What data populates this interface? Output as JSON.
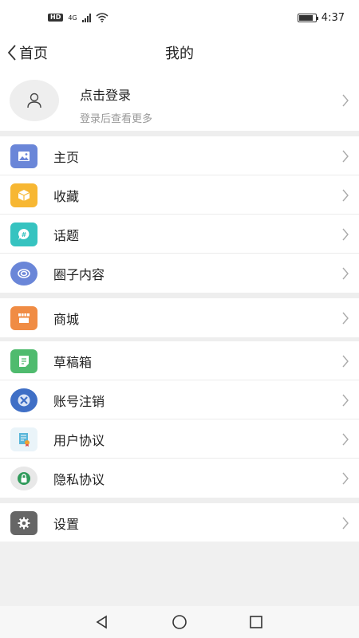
{
  "status_bar": {
    "hd": "HD",
    "network": "4G",
    "time": "4:37",
    "battery_level": 0.85
  },
  "nav": {
    "back_label": "首页",
    "title": "我的"
  },
  "profile": {
    "name": "点击登录",
    "subtitle": "登录后查看更多"
  },
  "menu": {
    "home": "主页",
    "favorites": "收藏",
    "topics": "话题",
    "circle": "圈子内容",
    "mall": "商城",
    "drafts": "草稿箱",
    "account_cancel": "账号注销",
    "user_agreement": "用户协议",
    "privacy": "隐私协议",
    "settings": "设置"
  },
  "colors": {
    "home_icon": "#6a86d8",
    "favorites_icon": "#f7b733",
    "topics_icon": "#36c3c0",
    "circle_icon": "#6a86d8",
    "mall_icon": "#f08c44",
    "drafts_icon": "#4fbb6e",
    "account_cancel_icon": "#3f6fc6",
    "user_agreement_icon": "#59b6d9",
    "privacy_icon": "#2f9a5a",
    "settings_icon": "#666666"
  }
}
